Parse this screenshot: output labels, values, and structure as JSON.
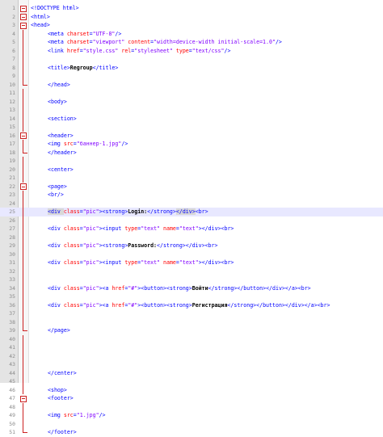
{
  "lines": [
    {
      "n": "1",
      "indent": 0,
      "fold": "open",
      "parts": [
        {
          "t": "<!DOCTYPE html>",
          "c": "tag"
        }
      ]
    },
    {
      "n": "2",
      "indent": 0,
      "fold": "open",
      "parts": [
        {
          "t": "<html>",
          "c": "tag"
        }
      ]
    },
    {
      "n": "3",
      "indent": 0,
      "fold": "open",
      "parts": [
        {
          "t": "<head>",
          "c": "tag"
        }
      ]
    },
    {
      "n": "4",
      "indent": 3,
      "fold": "line",
      "parts": [
        {
          "t": "<meta ",
          "c": "tag"
        },
        {
          "t": "charset",
          "c": "attr"
        },
        {
          "t": "=",
          "c": "tag"
        },
        {
          "t": "\"UTF-8\"",
          "c": "val"
        },
        {
          "t": "/>",
          "c": "tag"
        }
      ]
    },
    {
      "n": "5",
      "indent": 3,
      "fold": "line",
      "parts": [
        {
          "t": "<meta ",
          "c": "tag"
        },
        {
          "t": "charset",
          "c": "attr"
        },
        {
          "t": "=",
          "c": "tag"
        },
        {
          "t": "\"viewport\"",
          "c": "val"
        },
        {
          "t": " ",
          "c": "tag"
        },
        {
          "t": "content",
          "c": "attr"
        },
        {
          "t": "=",
          "c": "tag"
        },
        {
          "t": "\"width=device-width initial-scale=1.0\"",
          "c": "val"
        },
        {
          "t": "/>",
          "c": "tag"
        }
      ]
    },
    {
      "n": "6",
      "indent": 3,
      "fold": "line",
      "parts": [
        {
          "t": "<link ",
          "c": "tag"
        },
        {
          "t": "href",
          "c": "attr"
        },
        {
          "t": "=",
          "c": "tag"
        },
        {
          "t": "\"style.css\"",
          "c": "val"
        },
        {
          "t": " ",
          "c": "tag"
        },
        {
          "t": "rel",
          "c": "attr"
        },
        {
          "t": "=",
          "c": "tag"
        },
        {
          "t": "\"stylesheet\"",
          "c": "val"
        },
        {
          "t": " ",
          "c": "tag"
        },
        {
          "t": "type",
          "c": "attr"
        },
        {
          "t": "=",
          "c": "tag"
        },
        {
          "t": "\"text/css\"",
          "c": "val"
        },
        {
          "t": "/>",
          "c": "tag"
        }
      ]
    },
    {
      "n": "7",
      "indent": 0,
      "fold": "line",
      "parts": []
    },
    {
      "n": "8",
      "indent": 3,
      "fold": "line",
      "parts": [
        {
          "t": "<title>",
          "c": "tag"
        },
        {
          "t": "Regroup",
          "c": "txt"
        },
        {
          "t": "</title>",
          "c": "tag"
        }
      ]
    },
    {
      "n": "9",
      "indent": 0,
      "fold": "line",
      "parts": []
    },
    {
      "n": "10",
      "indent": 3,
      "fold": "end",
      "parts": [
        {
          "t": "</head>",
          "c": "tag"
        }
      ]
    },
    {
      "n": "11",
      "indent": 0,
      "fold": "line",
      "parts": []
    },
    {
      "n": "12",
      "indent": 3,
      "fold": "line",
      "parts": [
        {
          "t": "<body>",
          "c": "tag"
        }
      ]
    },
    {
      "n": "13",
      "indent": 0,
      "fold": "line",
      "parts": []
    },
    {
      "n": "14",
      "indent": 3,
      "fold": "line",
      "parts": [
        {
          "t": "<section>",
          "c": "tag"
        }
      ]
    },
    {
      "n": "15",
      "indent": 0,
      "fold": "line",
      "parts": []
    },
    {
      "n": "16",
      "indent": 3,
      "fold": "open",
      "parts": [
        {
          "t": "<header>",
          "c": "tag"
        }
      ]
    },
    {
      "n": "17",
      "indent": 3,
      "fold": "line",
      "parts": [
        {
          "t": "<img ",
          "c": "tag"
        },
        {
          "t": "src",
          "c": "attr"
        },
        {
          "t": "=",
          "c": "tag"
        },
        {
          "t": "\"баннер-1.jpg\"",
          "c": "val"
        },
        {
          "t": "/>",
          "c": "tag"
        }
      ]
    },
    {
      "n": "18",
      "indent": 3,
      "fold": "end",
      "parts": [
        {
          "t": "</header>",
          "c": "tag"
        }
      ]
    },
    {
      "n": "19",
      "indent": 0,
      "fold": "line",
      "parts": []
    },
    {
      "n": "20",
      "indent": 3,
      "fold": "line",
      "parts": [
        {
          "t": "<center>",
          "c": "tag"
        }
      ]
    },
    {
      "n": "21",
      "indent": 0,
      "fold": "line",
      "parts": []
    },
    {
      "n": "22",
      "indent": 3,
      "fold": "open",
      "parts": [
        {
          "t": "<page>",
          "c": "tag"
        }
      ]
    },
    {
      "n": "23",
      "indent": 3,
      "fold": "line",
      "parts": [
        {
          "t": "<br/>",
          "c": "tag"
        }
      ]
    },
    {
      "n": "24",
      "indent": 0,
      "fold": "line",
      "parts": []
    },
    {
      "n": "25",
      "indent": 3,
      "fold": "line",
      "current": true,
      "parts": [
        {
          "t": "<div ",
          "c": "tag",
          "hl": true
        },
        {
          "t": "class",
          "c": "attr"
        },
        {
          "t": "=",
          "c": "tag"
        },
        {
          "t": "\"pic\"",
          "c": "val"
        },
        {
          "t": ">",
          "c": "tag"
        },
        {
          "t": "<strong>",
          "c": "tag"
        },
        {
          "t": "Login:",
          "c": "txt"
        },
        {
          "t": "</strong>",
          "c": "tag"
        },
        {
          "t": "</div>",
          "c": "tag",
          "hl": true
        },
        {
          "t": "<br>",
          "c": "tag"
        }
      ]
    },
    {
      "n": "26",
      "indent": 0,
      "fold": "line",
      "parts": []
    },
    {
      "n": "27",
      "indent": 3,
      "fold": "line",
      "parts": [
        {
          "t": "<div ",
          "c": "tag"
        },
        {
          "t": "class",
          "c": "attr"
        },
        {
          "t": "=",
          "c": "tag"
        },
        {
          "t": "\"pic\"",
          "c": "val"
        },
        {
          "t": "><input ",
          "c": "tag"
        },
        {
          "t": "type",
          "c": "attr"
        },
        {
          "t": "=",
          "c": "tag"
        },
        {
          "t": "\"text\"",
          "c": "val"
        },
        {
          "t": " ",
          "c": "tag"
        },
        {
          "t": "name",
          "c": "attr"
        },
        {
          "t": "=",
          "c": "tag"
        },
        {
          "t": "\"text\"",
          "c": "val"
        },
        {
          "t": "></div><br>",
          "c": "tag"
        }
      ]
    },
    {
      "n": "28",
      "indent": 0,
      "fold": "line",
      "parts": []
    },
    {
      "n": "29",
      "indent": 3,
      "fold": "line",
      "parts": [
        {
          "t": "<div ",
          "c": "tag"
        },
        {
          "t": "class",
          "c": "attr"
        },
        {
          "t": "=",
          "c": "tag"
        },
        {
          "t": "\"pic\"",
          "c": "val"
        },
        {
          "t": "><strong>",
          "c": "tag"
        },
        {
          "t": "Password:",
          "c": "txt"
        },
        {
          "t": "</strong></div><br>",
          "c": "tag"
        }
      ]
    },
    {
      "n": "30",
      "indent": 0,
      "fold": "line",
      "parts": []
    },
    {
      "n": "31",
      "indent": 3,
      "fold": "line",
      "parts": [
        {
          "t": "<div ",
          "c": "tag"
        },
        {
          "t": "class",
          "c": "attr"
        },
        {
          "t": "=",
          "c": "tag"
        },
        {
          "t": "\"pic\"",
          "c": "val"
        },
        {
          "t": "><input ",
          "c": "tag"
        },
        {
          "t": "type",
          "c": "attr"
        },
        {
          "t": "=",
          "c": "tag"
        },
        {
          "t": "\"text\"",
          "c": "val"
        },
        {
          "t": " ",
          "c": "tag"
        },
        {
          "t": "name",
          "c": "attr"
        },
        {
          "t": "=",
          "c": "tag"
        },
        {
          "t": "\"text\"",
          "c": "val"
        },
        {
          "t": "></div><br>",
          "c": "tag"
        }
      ]
    },
    {
      "n": "32",
      "indent": 0,
      "fold": "line",
      "parts": []
    },
    {
      "n": "33",
      "indent": 0,
      "fold": "line",
      "parts": []
    },
    {
      "n": "34",
      "indent": 3,
      "fold": "line",
      "parts": [
        {
          "t": "<div ",
          "c": "tag"
        },
        {
          "t": "class",
          "c": "attr"
        },
        {
          "t": "=",
          "c": "tag"
        },
        {
          "t": "\"pic\"",
          "c": "val"
        },
        {
          "t": "><a ",
          "c": "tag"
        },
        {
          "t": "href",
          "c": "attr"
        },
        {
          "t": "=",
          "c": "tag"
        },
        {
          "t": "\"#\"",
          "c": "val"
        },
        {
          "t": "><button><strong>",
          "c": "tag"
        },
        {
          "t": "Войти",
          "c": "txt"
        },
        {
          "t": "</strong></button></div></a><br>",
          "c": "tag"
        }
      ]
    },
    {
      "n": "35",
      "indent": 0,
      "fold": "line",
      "parts": []
    },
    {
      "n": "36",
      "indent": 3,
      "fold": "line",
      "parts": [
        {
          "t": "<div ",
          "c": "tag"
        },
        {
          "t": "class",
          "c": "attr"
        },
        {
          "t": "=",
          "c": "tag"
        },
        {
          "t": "\"pic\"",
          "c": "val"
        },
        {
          "t": "><a ",
          "c": "tag"
        },
        {
          "t": "href",
          "c": "attr"
        },
        {
          "t": "=",
          "c": "tag"
        },
        {
          "t": "\"#\"",
          "c": "val"
        },
        {
          "t": "><button><strong>",
          "c": "tag"
        },
        {
          "t": "Регистрация",
          "c": "txt"
        },
        {
          "t": "</strong></button></div></a><br>",
          "c": "tag"
        }
      ]
    },
    {
      "n": "37",
      "indent": 0,
      "fold": "line",
      "parts": []
    },
    {
      "n": "38",
      "indent": 0,
      "fold": "line",
      "parts": []
    },
    {
      "n": "39",
      "indent": 3,
      "fold": "end",
      "parts": [
        {
          "t": "</page>",
          "c": "tag"
        }
      ]
    },
    {
      "n": "40",
      "indent": 0,
      "fold": "line",
      "parts": []
    },
    {
      "n": "41",
      "indent": 0,
      "fold": "line",
      "parts": []
    },
    {
      "n": "42",
      "indent": 0,
      "fold": "line",
      "parts": []
    },
    {
      "n": "43",
      "indent": 0,
      "fold": "line",
      "parts": []
    },
    {
      "n": "44",
      "indent": 3,
      "fold": "line",
      "parts": [
        {
          "t": "</center>",
          "c": "tag"
        }
      ]
    },
    {
      "n": "45",
      "indent": 0,
      "fold": "line",
      "parts": []
    },
    {
      "n": "46",
      "indent": 3,
      "fold": "line",
      "parts": [
        {
          "t": "<shop>",
          "c": "tag"
        }
      ]
    },
    {
      "n": "47",
      "indent": 3,
      "fold": "open",
      "parts": [
        {
          "t": "<footer>",
          "c": "tag"
        }
      ]
    },
    {
      "n": "48",
      "indent": 0,
      "fold": "line",
      "parts": []
    },
    {
      "n": "49",
      "indent": 3,
      "fold": "line",
      "parts": [
        {
          "t": "<img ",
          "c": "tag"
        },
        {
          "t": "src",
          "c": "attr"
        },
        {
          "t": "=",
          "c": "tag"
        },
        {
          "t": "\"1.jpg\"",
          "c": "val"
        },
        {
          "t": "/>",
          "c": "tag"
        }
      ]
    },
    {
      "n": "50",
      "indent": 0,
      "fold": "line",
      "parts": []
    },
    {
      "n": "51",
      "indent": 3,
      "fold": "end",
      "parts": [
        {
          "t": "</footer>",
          "c": "tag"
        }
      ]
    }
  ]
}
